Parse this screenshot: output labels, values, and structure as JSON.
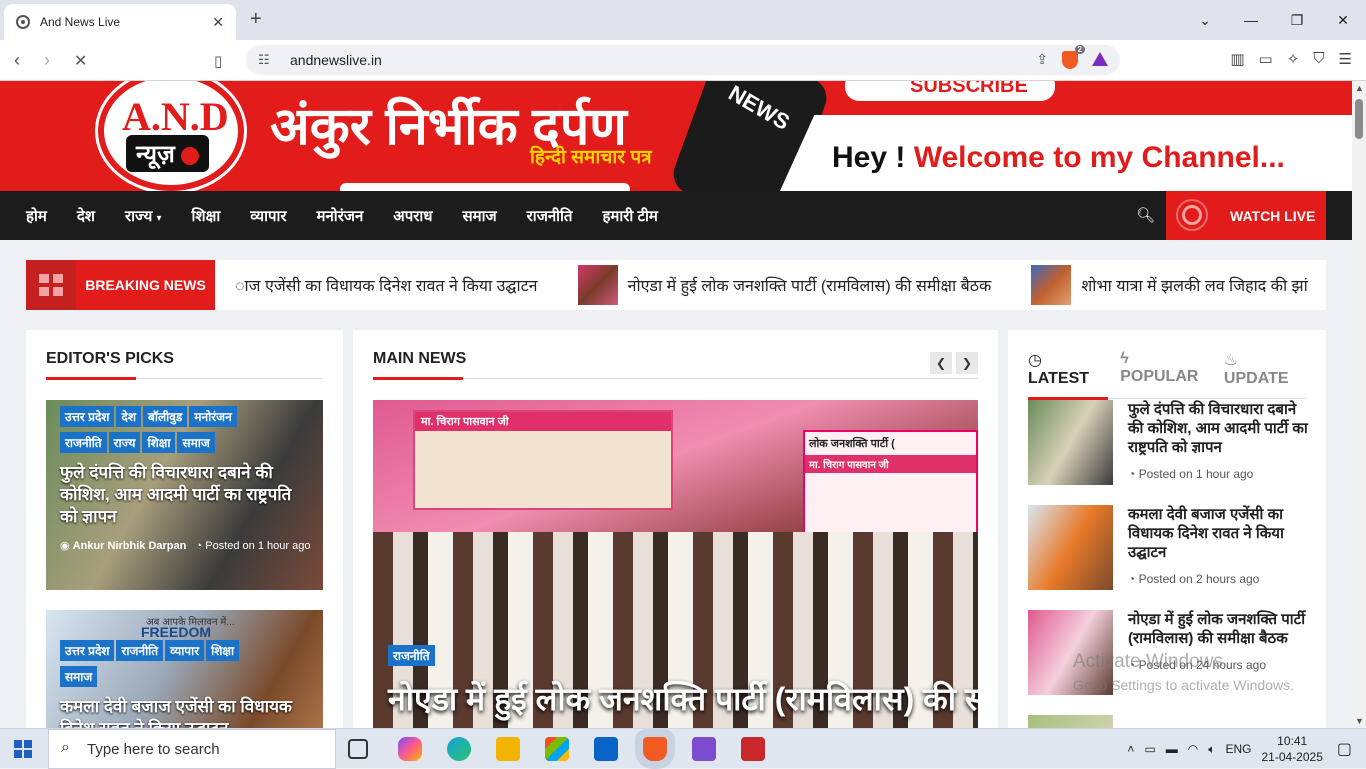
{
  "browser": {
    "tab_title": "And News Live",
    "url": "andnewslive.in",
    "shields_count": "2"
  },
  "banner": {
    "logo_and": "A.N.D",
    "logo_nyuz": "न्यूज़",
    "title": "अंकुर निर्भीक दर्पण",
    "subtitle": "हिन्दी समाचार पत्र",
    "mic_label": "NEWS",
    "subscribe": "SUBSCRIBE",
    "hey": "Hey !",
    "welcome": "Welcome to my Channel..."
  },
  "menu": {
    "items": [
      "होम",
      "देश",
      "राज्य",
      "शिक्षा",
      "व्यापार",
      "मनोरंजन",
      "अपराध",
      "समाज",
      "राजनीति",
      "हमारी टीम"
    ],
    "watch_live": "WATCH LIVE"
  },
  "breaking": {
    "label": "BREAKING NEWS",
    "items": [
      "ाज एजेंसी का विधायक दिनेश रावत ने किया उद्घाटन",
      "नोएडा में हुई लोक जनशक्ति पार्टी (रामविलास) की समीक्षा बैठक",
      "शोभा यात्रा में झलकी लव जिहाद की झां"
    ]
  },
  "editors_picks": {
    "heading": "EDITOR'S PICKS",
    "posts": [
      {
        "tags": [
          "उत्तर प्रदेश",
          "देश",
          "बॉलीवुड",
          "मनोरंजन",
          "राजनीति",
          "राज्य",
          "शिक्षा",
          "समाज"
        ],
        "title": "फुले दंपत्ति की विचारधारा दबाने की कोशिश, आम आदमी पार्टी का राष्ट्रपति को ज्ञापन",
        "author": "Ankur Nirbhik Darpan",
        "time": "Posted on 1 hour ago"
      },
      {
        "tags": [
          "उत्तर प्रदेश",
          "राजनीति",
          "व्यापार",
          "शिक्षा",
          "समाज"
        ],
        "title": "कमला देवी बजाज एजेंसी का विधायक दिनेश रावत ने किया उद्घाटन",
        "poster_text1": "अब आपके मिलावन में...",
        "poster_text2": "FREEDOM"
      }
    ]
  },
  "main_news": {
    "heading": "MAIN NEWS",
    "tag": "राजनीति",
    "title": "नोएडा में हुई लोक जनशक्ति पार्टी (रामविलास) की समीक्षा बैठक",
    "image_text1": "मा. चिराग पासवान जी",
    "image_text2": "लोक जनशक्ति पार्टी (",
    "image_text3": "मा. चिराग पासवान जी"
  },
  "sidebar": {
    "tabs": [
      "LATEST",
      "POPULAR",
      "UPDATE"
    ],
    "posts": [
      {
        "title": "फुले दंपत्ति की विचारधारा दबाने की कोशिश, आम आदमी पार्टी का राष्ट्रपति को ज्ञापन",
        "time": "Posted on 1 hour ago"
      },
      {
        "title": "कमला देवी बजाज एजेंसी का विधायक दिनेश रावत ने किया उद्घाटन",
        "time": "Posted on 2 hours ago"
      },
      {
        "title": "नोएडा में हुई लोक जनशक्ति पार्टी (रामविलास) की समीक्षा बैठक",
        "time": "Posted on 24 hours ago"
      }
    ]
  },
  "watermark": {
    "line1": "Activate Windows",
    "line2": "Go to Settings to activate Windows."
  },
  "taskbar": {
    "search_placeholder": "Type here to search",
    "lang": "ENG",
    "time": "10:41",
    "date": "21-04-2025"
  },
  "colors": {
    "brand_red": "#e21b1b",
    "tag_blue": "#1a73c9",
    "menu_dark": "#1c1c1c"
  }
}
